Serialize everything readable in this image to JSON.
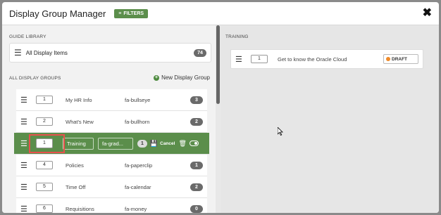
{
  "header": {
    "title": "Display Group Manager",
    "filters_label": "FILTERS",
    "close_symbol": "✖"
  },
  "library": {
    "section_label": "GUIDE LIBRARY",
    "item_label": "All Display Items",
    "count": "74"
  },
  "groups": {
    "section_label": "ALL DISPLAY GROUPS",
    "new_label": "New Display Group",
    "rows": [
      {
        "order": "1",
        "name": "My HR Info",
        "icon": "fa-bullseye",
        "count": "3"
      },
      {
        "order": "2",
        "name": "What's New",
        "icon": "fa-bullhorn",
        "count": "2"
      },
      {
        "order": "1",
        "name": "Training",
        "icon": "fa-grad...",
        "count": "1",
        "cancel": "Cancel",
        "editing": true
      },
      {
        "order": "4",
        "name": "Policies",
        "icon": "fa-paperclip",
        "count": "1"
      },
      {
        "order": "5",
        "name": "Time Off",
        "icon": "fa-calendar",
        "count": "2"
      },
      {
        "order": "6",
        "name": "Requisitions",
        "icon": "fa-money",
        "count": "0"
      }
    ]
  },
  "training": {
    "section_label": "TRAINING",
    "items": [
      {
        "order": "1",
        "name": "Get to know the Oracle Cloud",
        "status": "DRAFT"
      }
    ]
  },
  "colors": {
    "accent_green": "#5b8e4b",
    "highlight_red": "#e8514d",
    "draft_orange": "#ef8a28"
  },
  "icons": [
    "filter-icon",
    "close-icon",
    "list-icon",
    "plus-circle-icon",
    "hamburger-icon",
    "save-icon",
    "trash-icon",
    "toggle-icon",
    "cursor-icon"
  ]
}
